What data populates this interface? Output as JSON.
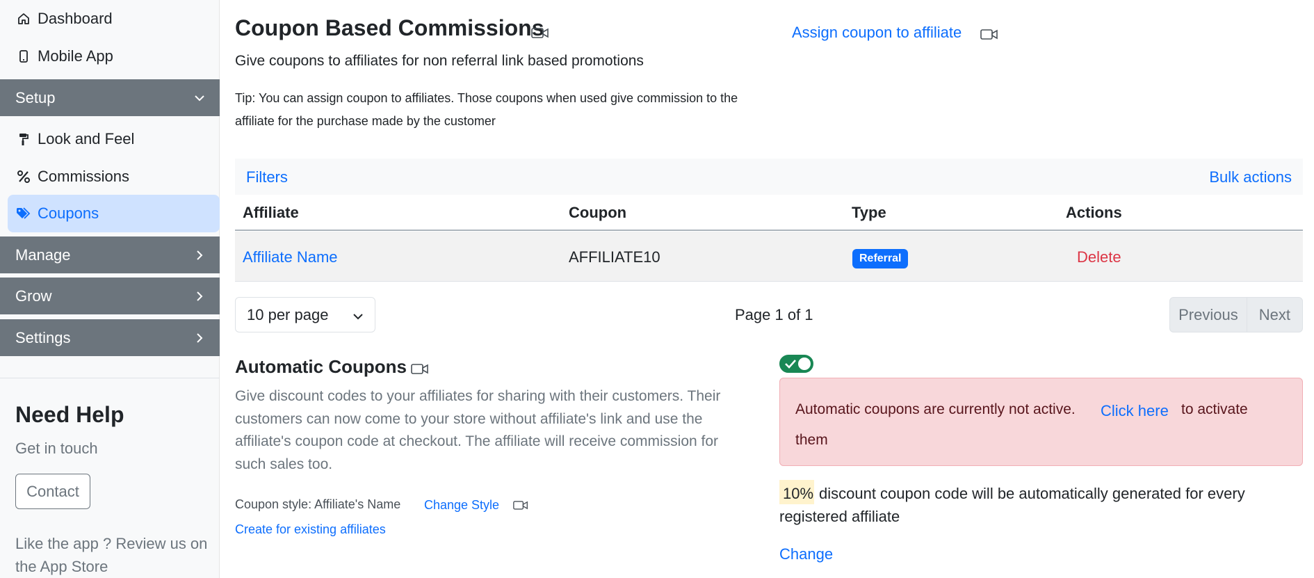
{
  "sidebar": {
    "items": [
      {
        "label": "Dashboard",
        "icon": "home-icon"
      },
      {
        "label": "Mobile App",
        "icon": "phone-icon"
      }
    ],
    "sections": {
      "setup": "Setup",
      "manage": "Manage",
      "grow": "Grow",
      "settings": "Settings"
    },
    "setup_items": [
      {
        "label": "Look and Feel",
        "icon": "paint-roller-icon"
      },
      {
        "label": "Commissions",
        "icon": "percent-icon"
      },
      {
        "label": "Coupons",
        "icon": "tags-icon",
        "active": true
      }
    ],
    "help": {
      "title": "Need Help",
      "subtitle": "Get in touch",
      "contact_label": "Contact",
      "review_text": "Like the app ? Review us on the App Store"
    }
  },
  "main": {
    "title": "Coupon Based Commissions",
    "subtitle": "Give coupons to affiliates for non referral link based promotions",
    "assign_link": "Assign coupon to affiliate",
    "tip_line1": "Tip: You can assign coupon to affiliates. Those coupons when used give commission to the",
    "tip_line2": "affiliate for the purchase made by the customer",
    "filters_label": "Filters",
    "bulk_actions_label": "Bulk actions",
    "table": {
      "columns": [
        "Affiliate",
        "Coupon",
        "Type",
        "Actions"
      ],
      "rows": [
        {
          "affiliate": "Affiliate Name",
          "coupon": "AFFILIATE10",
          "type": "Referral",
          "action": "Delete"
        }
      ]
    },
    "pagination": {
      "per_page": "10 per page",
      "page_info": "Page 1 of 1",
      "previous": "Previous",
      "next": "Next"
    },
    "auto": {
      "title": "Automatic Coupons",
      "desc_l1": "Give discount codes to your affiliates for sharing with their customers. Their",
      "desc_l2": "customers can now come to your store without affiliate's link and use the",
      "desc_l3": "affiliate's coupon code at checkout. The affiliate will receive commission for",
      "desc_l4": "such sales too.",
      "style_label": "Coupon style: Affiliate's Name",
      "change_style": "Change Style",
      "create_existing": "Create for existing affiliates",
      "toggle_on": true,
      "alert_text": "Automatic coupons are currently not active.",
      "alert_link": "Click here",
      "alert_suffix": "to activate",
      "alert_suffix2": "them",
      "discount_value": "10%",
      "discount_text": "discount coupon code will be automatically generated for every",
      "discount_text2": "registered affiliate",
      "change_label": "Change"
    }
  },
  "colors": {
    "primary": "#0d6efd",
    "section_bg": "#6c757d",
    "active_bg": "#cfe2ff",
    "danger": "#dc3545",
    "success": "#198754",
    "alert_bg": "#f8d7da"
  }
}
